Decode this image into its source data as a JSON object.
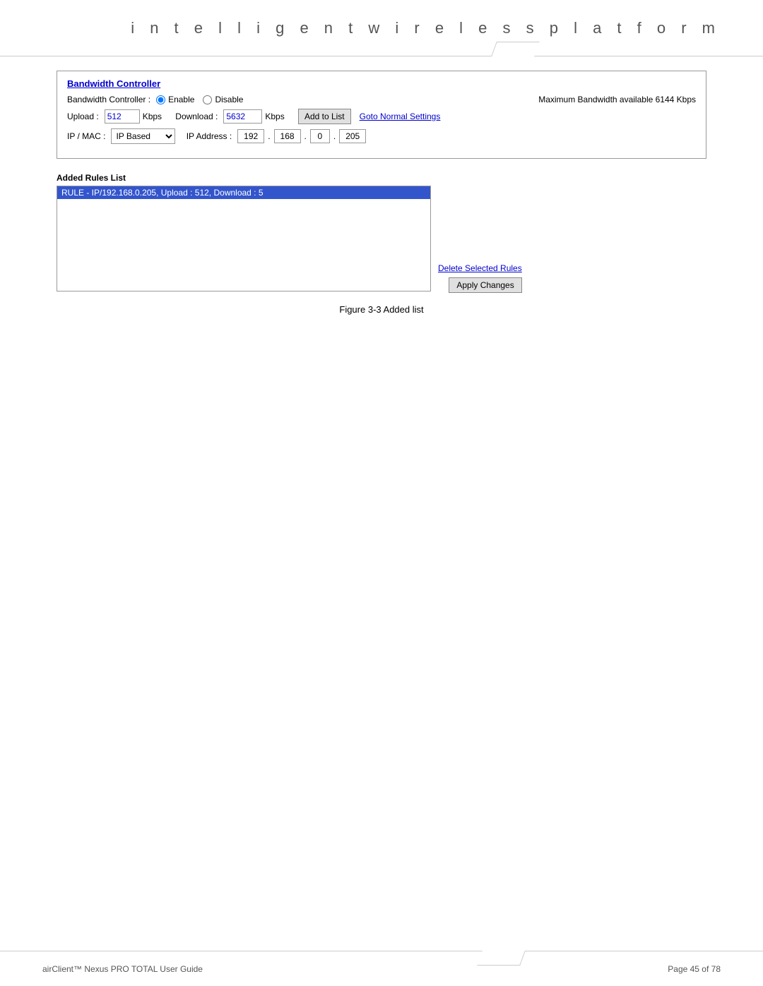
{
  "header": {
    "title": "i n t e l l i g e n t   w i r e l e s s   p l a t f o r m"
  },
  "panel": {
    "title": "Bandwidth Controller",
    "controller_label": "Bandwidth Controller :",
    "enable_label": "Enable",
    "disable_label": "Disable",
    "max_bandwidth_text": "Maximum Bandwidth available 6144 Kbps",
    "upload_label": "Upload :",
    "upload_value": "512",
    "upload_unit": "Kbps",
    "download_label": "Download :",
    "download_value": "5632",
    "download_unit": "Kbps",
    "add_to_list_label": "Add to List",
    "goto_normal_label": "Goto Normal Settings",
    "ip_mac_label": "IP / MAC :",
    "ip_mac_value": "IP Based",
    "ip_address_label": "IP Address :",
    "ip1": "192",
    "ip2": "168",
    "ip3": "0",
    "ip4": "205"
  },
  "added_rules": {
    "section_label": "Added Rules List",
    "rule_text": "RULE - IP/192.168.0.205, Upload : 512, Download : 5",
    "delete_label": "Delete Selected Rules",
    "apply_label": "Apply Changes"
  },
  "figure": {
    "caption": "Figure 3-3 Added list"
  },
  "footer": {
    "left_text": "airClient™ Nexus PRO TOTAL User Guide",
    "right_text": "Page 45 of 78"
  }
}
